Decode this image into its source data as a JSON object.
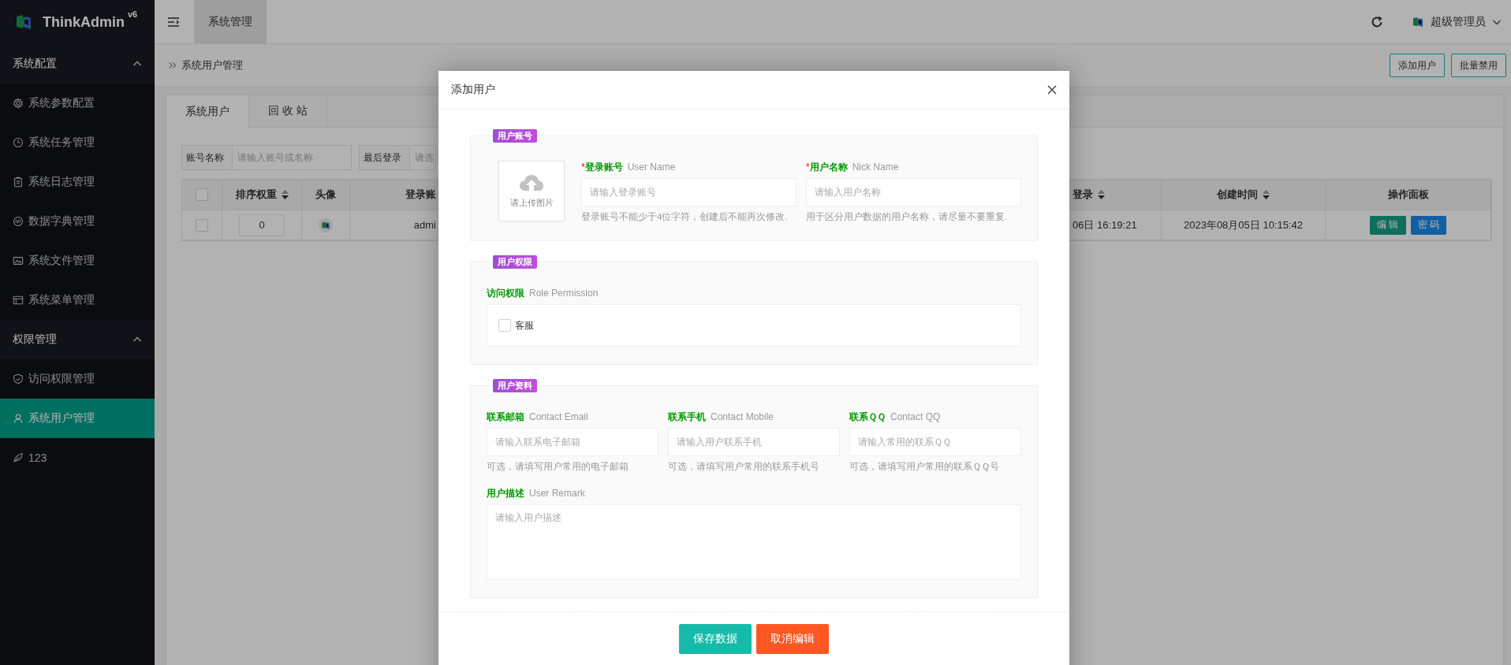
{
  "sidebar": {
    "brand": "ThinkAdmin",
    "version": "v6",
    "items": [
      {
        "kind": "group",
        "label": "系统配置",
        "expanded": true,
        "children": [
          {
            "kind": "item",
            "label": "系统参数配置",
            "selected": false
          },
          {
            "kind": "item",
            "label": "系统任务管理",
            "selected": false
          },
          {
            "kind": "item",
            "label": "系统日志管理",
            "selected": false
          },
          {
            "kind": "item",
            "label": "数据字典管理",
            "selected": false
          },
          {
            "kind": "item",
            "label": "系统文件管理",
            "selected": false
          },
          {
            "kind": "item",
            "label": "系统菜单管理",
            "selected": false
          }
        ]
      },
      {
        "kind": "group",
        "label": "权限管理",
        "expanded": true,
        "children": [
          {
            "kind": "item",
            "label": "访问权限管理",
            "selected": false
          },
          {
            "kind": "item",
            "label": "系统用户管理",
            "selected": true
          }
        ]
      },
      {
        "kind": "item",
        "label": "123",
        "selected": false
      }
    ]
  },
  "header": {
    "tabs": [
      {
        "label": "系统管理",
        "selected": true
      }
    ],
    "user": "超级管理员"
  },
  "breadcrumb": {
    "title": "系统用户管理",
    "actions": [
      "添加用户",
      "批量禁用"
    ]
  },
  "content_tabs": [
    {
      "label": "系统用户",
      "selected": true
    },
    {
      "label": "回 收 站",
      "selected": false
    }
  ],
  "filters": [
    {
      "label": "账号名称",
      "placeholder": "请输入账号或名称"
    },
    {
      "label": "最后登录",
      "placeholder": "请选"
    }
  ],
  "table": {
    "header_checked": false,
    "columns": [
      {
        "label": "排序权重",
        "sortable": true
      },
      {
        "label": "头像",
        "sortable": false
      },
      {
        "label": "登录账",
        "sortable": false
      },
      {
        "label": "登录",
        "sortable": true
      },
      {
        "label": "创建时间",
        "sortable": true
      },
      {
        "label": "操作面板",
        "sortable": false
      }
    ],
    "rows": [
      {
        "checked": false,
        "sort": "0",
        "login": "admi",
        "last_login": "06日 16:19:21",
        "created": "2023年08月05日 10:15:42",
        "actions": [
          {
            "label": "编 辑",
            "kind": "edit"
          },
          {
            "label": "密 码",
            "kind": "password"
          }
        ]
      }
    ]
  },
  "modal": {
    "title": "添加用户",
    "sections": [
      {
        "kind": "account",
        "legend": "用户账号",
        "upload": "请上传图片",
        "fields": [
          {
            "label": "登录账号",
            "sublabel": "User Name",
            "marker": "*",
            "placeholder": "请输入登录账号",
            "hint": "登录账号不能少于4位字符，创建后不能再次修改."
          },
          {
            "label": "用户名称",
            "sublabel": "Nick Name",
            "marker": "*",
            "placeholder": "请输入用户名称",
            "hint": "用于区分用户数据的用户名称，请尽量不要重复."
          }
        ]
      },
      {
        "kind": "permission",
        "legend": "用户权限",
        "label": "访问权限",
        "sublabel": "Role Permission",
        "options": [
          {
            "label": "客服",
            "checked": false
          }
        ]
      },
      {
        "kind": "profile",
        "legend": "用户资料",
        "fields": [
          {
            "label": "联系邮箱",
            "sublabel": "Contact Email",
            "placeholder": "请输入联系电子邮箱",
            "hint": "可选，请填写用户常用的电子邮箱"
          },
          {
            "label": "联系手机",
            "sublabel": "Contact Mobile",
            "placeholder": "请输入用户联系手机",
            "hint": "可选，请填写用户常用的联系手机号"
          },
          {
            "label": "联系ＱＱ",
            "sublabel": "Contact QQ",
            "placeholder": "请输入常用的联系ＱＱ",
            "hint": "可选，请填写用户常用的联系ＱＱ号"
          }
        ],
        "remark": {
          "label": "用户描述",
          "sublabel": "User Remark",
          "placeholder": "请输入用户描述"
        }
      }
    ],
    "buttons": [
      {
        "label": "保存数据",
        "kind": "primary"
      },
      {
        "label": "取消编辑",
        "kind": "danger"
      }
    ]
  }
}
